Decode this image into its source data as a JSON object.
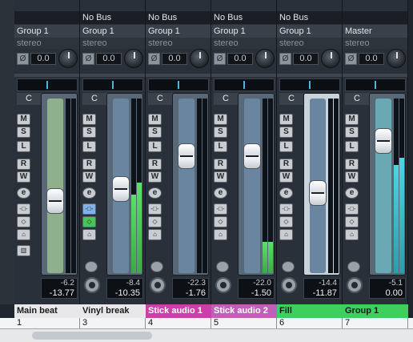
{
  "strips": [
    {
      "bus": "",
      "group": "Group 1",
      "stereo": "stereo",
      "gain": "0.0",
      "pan": "C",
      "peak": "-6.2",
      "level": "-13.77",
      "name": "Main beat",
      "number": "1",
      "color": "#e8e8ea",
      "track": "green",
      "fader": 0.6,
      "meterL": 0.0,
      "meterR": 0.0,
      "buttons": [
        "M",
        "S",
        "L",
        "R",
        "W",
        "e",
        "",
        "",
        "",
        ""
      ]
    },
    {
      "bus": "No Bus",
      "group": "Group 1",
      "stereo": "stereo",
      "gain": "0.0",
      "pan": "C",
      "peak": "-8.4",
      "level": "-10.35",
      "name": "Vinyl break",
      "number": "3",
      "color": "#e8e8ea",
      "track": "blue",
      "fader": 0.52,
      "meterL": 0.45,
      "meterR": 0.52,
      "buttons": [
        "M",
        "S",
        "L",
        "R",
        "W",
        "e",
        "",
        "",
        ""
      ]
    },
    {
      "bus": "No Bus",
      "group": "Group 1",
      "stereo": "stereo",
      "gain": "0.0",
      "pan": "C",
      "peak": "-22.3",
      "level": "-1.76",
      "name": "Stick audio 1",
      "number": "4",
      "color": "#cc3fa8",
      "track": "blue",
      "fader": 0.3,
      "meterL": 0.0,
      "meterR": 0.0,
      "buttons": [
        "M",
        "S",
        "L",
        "R",
        "W",
        "e",
        "",
        "",
        ""
      ]
    },
    {
      "bus": "No Bus",
      "group": "Group 1",
      "stereo": "stereo",
      "gain": "0.0",
      "pan": "C",
      "peak": "-22.0",
      "level": "-1.50",
      "name": "Stick audio 2",
      "number": "5",
      "color": "#c05fb8",
      "track": "blue",
      "fader": 0.3,
      "meterL": 0.18,
      "meterR": 0.18,
      "buttons": [
        "M",
        "S",
        "L",
        "R",
        "W",
        "e",
        "",
        "",
        ""
      ]
    },
    {
      "bus": "No Bus",
      "group": "Group 1",
      "stereo": "stereo",
      "gain": "0.0",
      "pan": "C",
      "peak": "-14.4",
      "level": "-11.87",
      "name": "Fill",
      "number": "6",
      "color": "#3fcf5f",
      "track": "blue",
      "fader": 0.55,
      "meterL": 0.0,
      "meterR": 0.0,
      "buttons": [
        "M",
        "S",
        "L",
        "R",
        "W",
        "e",
        "",
        "",
        ""
      ]
    },
    {
      "bus": "",
      "group": "Master",
      "stereo": "stereo",
      "gain": "0.0",
      "pan": "C",
      "peak": "-5.1",
      "level": "0.00",
      "name": "Group 1",
      "number": "7",
      "color": "#3fcf5f",
      "track": "teal",
      "fader": 0.2,
      "meterL": 0.62,
      "meterR": 0.66,
      "buttons": [
        "M",
        "S",
        "L",
        "R",
        "W",
        "e",
        "",
        "",
        ""
      ]
    }
  ]
}
